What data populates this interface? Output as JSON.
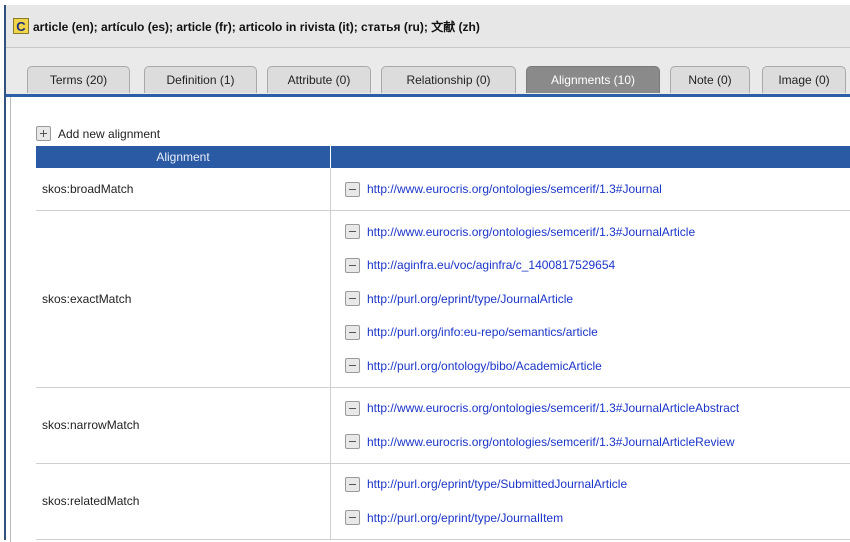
{
  "header": {
    "badge": "C",
    "title": "article (en); artículo (es); article (fr); articolo in rivista (it); статья (ru); 文献 (zh)"
  },
  "tabs": [
    {
      "label": "Terms (20)"
    },
    {
      "label": "Definition (1)"
    },
    {
      "label": "Attribute (0)"
    },
    {
      "label": "Relationship (0)"
    },
    {
      "label": "Alignments (10)",
      "active": true
    },
    {
      "label": "Note (0)"
    },
    {
      "label": "Image (0)"
    }
  ],
  "content": {
    "add_label": "Add new alignment",
    "table_header": "Alignment",
    "rows": [
      {
        "type": "skos:broadMatch",
        "uris": [
          "http://www.eurocris.org/ontologies/semcerif/1.3#Journal"
        ]
      },
      {
        "type": "skos:exactMatch",
        "uris": [
          "http://www.eurocris.org/ontologies/semcerif/1.3#JournalArticle",
          "http://aginfra.eu/voc/aginfra/c_1400817529654",
          "http://purl.org/eprint/type/JournalArticle",
          "http://purl.org/info:eu-repo/semantics/article",
          "http://purl.org/ontology/bibo/AcademicArticle"
        ]
      },
      {
        "type": "skos:narrowMatch",
        "uris": [
          "http://www.eurocris.org/ontologies/semcerif/1.3#JournalArticleAbstract",
          "http://www.eurocris.org/ontologies/semcerif/1.3#JournalArticleReview"
        ]
      },
      {
        "type": "skos:relatedMatch",
        "uris": [
          "http://purl.org/eprint/type/SubmittedJournalArticle",
          "http://purl.org/eprint/type/JournalItem"
        ]
      }
    ]
  },
  "colors": {
    "accent": "#2a5aa3",
    "link": "#1b35c8",
    "active_tab": "#8a8a8a"
  }
}
